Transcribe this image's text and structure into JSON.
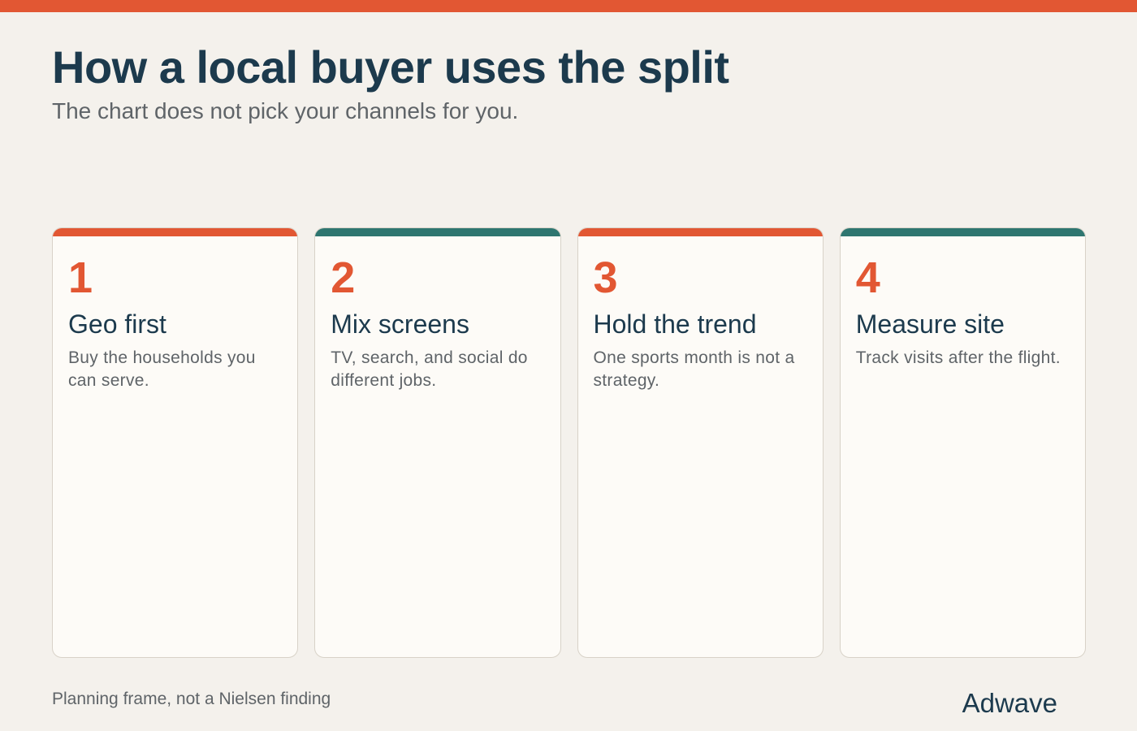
{
  "header": {
    "title": "How a local buyer uses the split",
    "subtitle": "The chart does not pick your channels for you."
  },
  "cards": [
    {
      "number": "1",
      "title": "Geo first",
      "description": "Buy the households you can serve.",
      "accent": "#e25733"
    },
    {
      "number": "2",
      "title": "Mix screens",
      "description": "TV, search, and social do different jobs.",
      "accent": "#2e7670"
    },
    {
      "number": "3",
      "title": "Hold the trend",
      "description": "One sports month is not a strategy.",
      "accent": "#e25733"
    },
    {
      "number": "4",
      "title": "Measure site",
      "description": "Track visits after the flight.",
      "accent": "#2e7670"
    }
  ],
  "footer": {
    "note": "Planning frame, not a Nielsen finding",
    "brand": "Adwave"
  },
  "colors": {
    "accent_orange": "#e25733",
    "accent_teal": "#2e7670",
    "text_dark": "#1c3a4d",
    "text_muted": "#5f6468",
    "background": "#f4f1ec",
    "card_background": "#fdfbf7"
  }
}
